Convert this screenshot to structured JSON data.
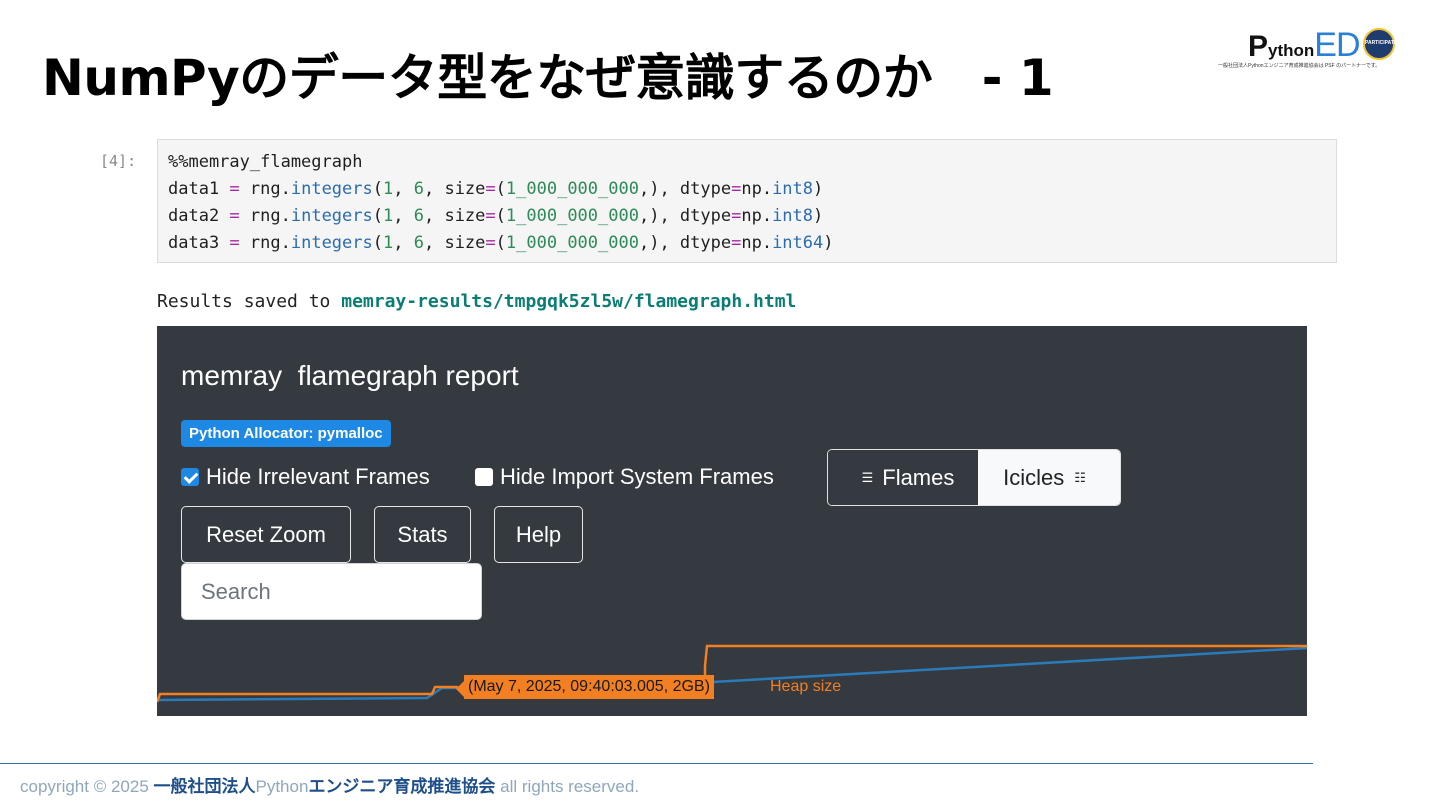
{
  "slide": {
    "title": "NumPyのデータ型をなぜ意識するのか　- 1"
  },
  "logo": {
    "p": "P",
    "ython": "ython",
    "ed": "ED",
    "badge": "PARTICIPATING",
    "subtext": "一般社団法人Pythonエンジニア育成推進協会は PSF のパートナーです。"
  },
  "notebook": {
    "prompt": "[4]:",
    "code": {
      "magic": "%%memray_flamegraph",
      "lines": [
        {
          "var": "data1",
          "call": "integers",
          "dtype": "int8"
        },
        {
          "var": "data2",
          "call": "integers",
          "dtype": "int8"
        },
        {
          "var": "data3",
          "call": "integers",
          "dtype": "int64"
        }
      ],
      "tokens": {
        "assign": " = rng.",
        "open": "(",
        "low": "1",
        "sep": ", ",
        "high": "6",
        "size_kw": "size",
        "eq": "=",
        "size_val": "1_000_000_000",
        "size_tail": ",), dtype",
        "np": "np.",
        "close": ")"
      }
    },
    "results_prefix": "Results saved to ",
    "results_link": "memray-results/tmpgqk5zl5w/flamegraph.html"
  },
  "report": {
    "title": "memray  flamegraph report",
    "allocator_badge": "Python Allocator: pymalloc",
    "hide_irrelevant": {
      "label": "Hide Irrelevant Frames",
      "checked": true
    },
    "hide_import": {
      "label": "Hide Import System Frames",
      "checked": false
    },
    "view_toggle": {
      "flames": "Flames",
      "icicles": "Icicles",
      "selected": "Icicles"
    },
    "buttons": {
      "reset_zoom": "Reset Zoom",
      "stats": "Stats",
      "help": "Help"
    },
    "search_placeholder": "Search",
    "tooltip": "(May 7, 2025, 09:40:03.005, 2GB)",
    "heap_label": "Heap size",
    "colors": {
      "heap_line": "#f27f22",
      "resident_line": "#2b7bba",
      "panel_bg": "#343a40",
      "accent": "#1e88e5"
    }
  },
  "footer": {
    "prefix": "copyright © 2025 ",
    "org": "一般社団法人",
    "python": "Python",
    "org2": "エンジニア育成推進協会",
    "suffix": " all rights reserved."
  }
}
